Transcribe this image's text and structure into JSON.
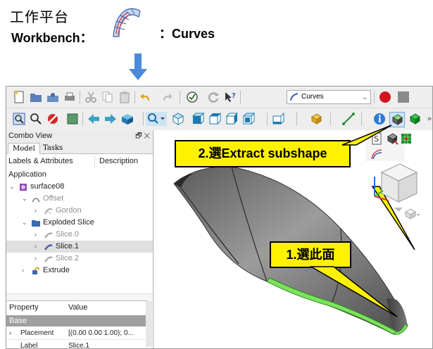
{
  "header": {
    "title_cn": "工作平台",
    "workbench_label": "Workbench：",
    "curves_label": "：Curves"
  },
  "toolbar": {
    "workbench_selector_value": "Curves"
  },
  "combo_view": {
    "title": "Combo View",
    "tabs": [
      "Model",
      "Tasks"
    ],
    "columns": [
      "Labels & Attributes",
      "Description"
    ],
    "root": "Application",
    "tree": [
      {
        "label": "surface08",
        "expanded": true
      },
      {
        "label": "Offset",
        "expanded": true,
        "greyed": true
      },
      {
        "label": "Gordon",
        "greyed": true
      },
      {
        "label": "Exploded Slice",
        "expanded": true
      },
      {
        "label": "Slice.0",
        "greyed": true
      },
      {
        "label": "Slice.1",
        "selected": true
      },
      {
        "label": "Slice.2",
        "greyed": true
      },
      {
        "label": "Extrude"
      }
    ]
  },
  "properties": {
    "columns": [
      "Property",
      "Value"
    ],
    "group": "Base",
    "rows": [
      {
        "name": "Placement",
        "value": "[(0.00 0.00 1.00); 0..."
      },
      {
        "name": "Label",
        "value": "Slice.1"
      }
    ]
  },
  "annotations": {
    "step2": "2.選Extract subshape",
    "step1": "1.選此面"
  },
  "colors": {
    "callout_fill": "#fff200",
    "highlight_face": "#7de35e",
    "arrow_blue": "#4a8ad8"
  }
}
